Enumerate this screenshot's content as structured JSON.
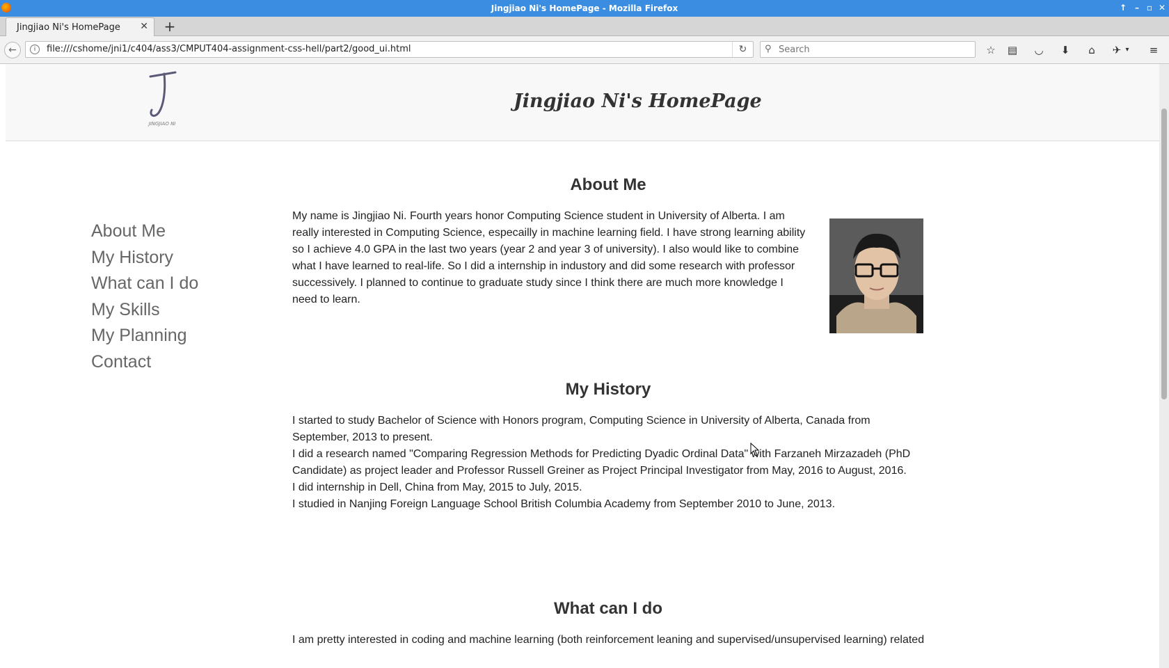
{
  "window": {
    "title": "Jingjiao Ni's HomePage - Mozilla Firefox"
  },
  "tab": {
    "label": "Jingjiao Ni's HomePage",
    "close_glyph": "✕",
    "new_tab_glyph": "+"
  },
  "navbar": {
    "url": "file:///cshome/jni1/c404/ass3/CMPUT404-assignment-css-hell/part2/good_ui.html",
    "search_placeholder": "Search"
  },
  "toolbar_icons": [
    "back-icon",
    "reload-icon",
    "bookmark-star-icon",
    "reading-list-icon",
    "pocket-icon",
    "download-icon",
    "home-icon",
    "extension-icon",
    "menu-icon"
  ],
  "header": {
    "logo_caption": "JINGJIAO NI",
    "title": "Jingjiao Ni's HomePage"
  },
  "nav": {
    "items": [
      "About Me",
      "My History",
      "What can I do",
      "My Skills",
      "My Planning",
      "Contact"
    ]
  },
  "about": {
    "heading": "About Me",
    "lines": [
      "My name is Jingjiao Ni. Fourth years honor Computing Science student in University of Alberta. I am",
      "really interested in Computing Science, especailly in machine learning field. I have strong learning ability",
      "so I achieve 4.0 GPA in the last two years (year 2 and year 3 of university). I also would like to combine",
      "what I have learned to real-life. So I did a internship in industory and did some research with professor",
      "successively. I planned to continue to graduate study since I think there are much more knowledge I",
      "need to learn."
    ]
  },
  "history": {
    "heading": "My History",
    "lines": [
      "I started to study Bachelor of Science with Honors program, Computing Science in University of Alberta, Canada from",
      "September, 2013 to present.",
      "I did a research named \"Comparing Regression Methods for Predicting Dyadic Ordinal Data\" with Farzaneh Mirzazadeh (PhD",
      "Candidate) as project leader and Professor Russell Greiner as Project Principal Investigator from May, 2016 to August, 2016.",
      "I did internship in Dell, China from May, 2015 to July, 2015.",
      "I studied in Nanjing Foreign Language School British Columbia Academy from September 2010 to June, 2013."
    ]
  },
  "whatcanido": {
    "heading": "What can I do",
    "lines": [
      "I am pretty interested in coding and machine learning (both reinforcement leaning and supervised/unsupervised learning) related"
    ]
  },
  "colors": {
    "titlebar": "#3a8de0",
    "text": "#222222",
    "nav_link": "#666666",
    "header_bg": "#f8f8f8"
  }
}
